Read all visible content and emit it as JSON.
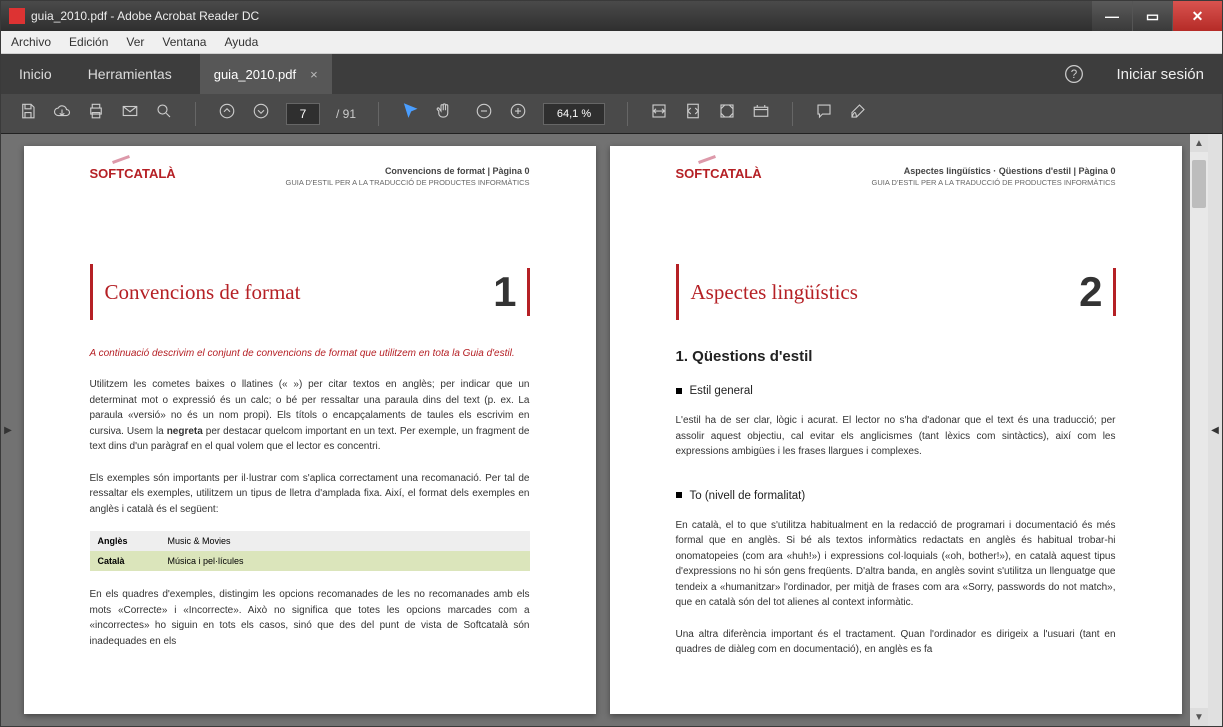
{
  "window": {
    "title": "guia_2010.pdf - Adobe Acrobat Reader DC"
  },
  "menu": {
    "items": [
      "Archivo",
      "Edición",
      "Ver",
      "Ventana",
      "Ayuda"
    ]
  },
  "tabs": {
    "home": "Inicio",
    "tools": "Herramientas",
    "doc": "guia_2010.pdf",
    "signin": "Iniciar sesión"
  },
  "toolbar": {
    "page_current": "7",
    "page_total": "/  91",
    "zoom": "64,1 %"
  },
  "pages": {
    "left": {
      "logo": "SOFTCATALÀ",
      "hdr_line1": "Convencions de format |  Pàgina 0",
      "hdr_line2": "GUIA D'ESTIL PER A LA TRADUCCIÓ DE PRODUCTES INFORMÀTICS",
      "chapter_title": "Convencions de format",
      "chapter_num": "1",
      "intro": "A continuació descrivim el conjunt de convencions de format que utilitzem en tota la Guia d'estil.",
      "p1": "Utilitzem les cometes baixes o llatines (« ») per citar textos en anglès; per indicar que un determinat mot o expressió és un calc; o bé per ressaltar una paraula dins del text (p. ex. La paraula «versió» no és un nom propi). Els títols o encapçalaments de taules els escrivim en cursiva. Usem la ",
      "p1_bold": "negreta",
      "p1_tail": " per destacar quelcom important en un text. Per exemple, un fragment de text dins d'un paràgraf en el qual volem que el lector es concentri.",
      "p2": "Els exemples són importants per il·lustrar com s'aplica correctament una recomanació. Per tal de ressaltar els exemples, utilitzem un tipus de lletra d'amplada fixa. Així, el format dels exemples en anglès i català és el següent:",
      "tbl_r1c1": "Anglès",
      "tbl_r1c2": "Music & Movies",
      "tbl_r2c1": "Català",
      "tbl_r2c2": "Música i pel·lícules",
      "p3": "En els quadres d'exemples, distingim les opcions recomanades de les no recomanades amb els mots «Correcte» i «Incorrecte». Això no significa que totes les opcions marcades com a «incorrectes» ho siguin en tots els casos, sinó que des del punt de vista de Softcatalà són inadequades en els"
    },
    "right": {
      "logo": "SOFTCATALÀ",
      "hdr_line1": "Aspectes lingüístics · Qüestions d'estil |  Pàgina 0",
      "hdr_line2": "GUIA D'ESTIL PER A LA TRADUCCIÓ DE PRODUCTES INFORMÀTICS",
      "chapter_title": "Aspectes lingüístics",
      "chapter_num": "2",
      "h1": "1. Qüestions d'estil",
      "h2a": "Estil general",
      "p1": "L'estil ha de ser clar, lògic i acurat. El lector no s'ha d'adonar que el text és una traducció; per assolir aquest objectiu, cal evitar els anglicismes (tant lèxics com sintàctics), així com les expressions ambigües i les frases llargues i complexes.",
      "h2b": "To (nivell de formalitat)",
      "p2": "En català, el to que s'utilitza habitualment en la redacció de programari i documentació és més formal que en anglès. Si bé als textos informàtics redactats en anglès és habitual trobar-hi onomatopeies (com ara «huh!») i expressions col·loquials («oh, bother!»), en català aquest tipus d'expressions no hi són gens freqüents. D'altra banda, en anglès sovint s'utilitza un llenguatge que tendeix a «humanitzar» l'ordinador, per mitjà de frases com ara «Sorry, passwords do not match», que en català són del tot alienes al context informàtic.",
      "p3": "Una altra diferència important és el tractament. Quan l'ordinador es dirigeix a l'usuari (tant en quadres de diàleg com en documentació), en anglès es fa"
    }
  }
}
